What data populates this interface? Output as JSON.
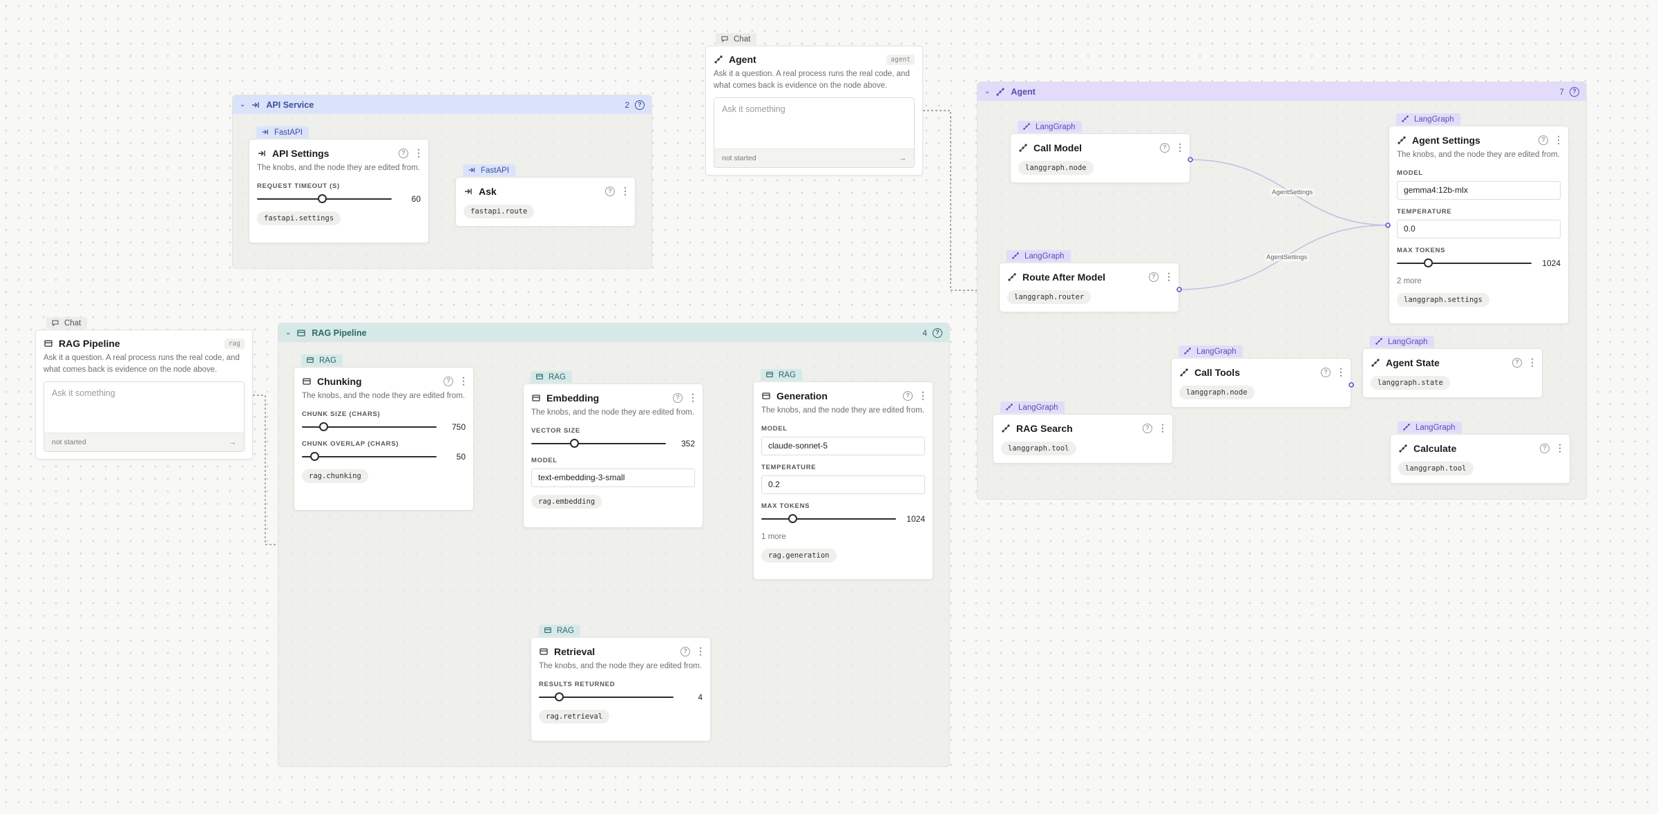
{
  "common": {
    "desc": "The knobs, and the node they are edited from.",
    "help": "?",
    "menu": "⋮",
    "collapse": "⌄"
  },
  "colors": {
    "fastapi": "#dbe3fb",
    "langgraph": "#e2dcfa",
    "rag": "#d6e9e8",
    "wire": "#5b4fd1"
  },
  "groups": {
    "api": {
      "title": "API Service",
      "count": "2"
    },
    "agent": {
      "title": "Agent",
      "count": "7"
    },
    "rag": {
      "title": "RAG Pipeline",
      "count": "4"
    }
  },
  "chat_agent": {
    "tag": "Chat",
    "title": "Agent",
    "badge": "agent",
    "desc": "Ask it a question. A real process runs the real code, and what comes back is evidence on the node above.",
    "placeholder": "Ask it something",
    "status": "not started",
    "send": "→"
  },
  "chat_rag": {
    "tag": "Chat",
    "title": "RAG Pipeline",
    "badge": "rag",
    "desc": "Ask it a question. A real process runs the real code, and what comes back is evidence on the node above.",
    "placeholder": "Ask it something",
    "status": "not started",
    "send": "→"
  },
  "api_settings": {
    "tag": "FastAPI",
    "title": "API Settings",
    "field_label": "REQUEST TIMEOUT (S)",
    "value": "60",
    "value_fraction": 0.48,
    "chip": "fastapi.settings"
  },
  "ask": {
    "tag": "FastAPI",
    "title": "Ask",
    "chip": "fastapi.route"
  },
  "call_model": {
    "tag": "LangGraph",
    "title": "Call Model",
    "chip": "langgraph.node"
  },
  "route_after_model": {
    "tag": "LangGraph",
    "title": "Route After Model",
    "chip": "langgraph.router"
  },
  "agent_settings": {
    "tag": "LangGraph",
    "title": "Agent Settings",
    "model_label": "MODEL",
    "model": "gemma4:12b-mlx",
    "temp_label": "TEMPERATURE",
    "temp": "0.0",
    "tokens_label": "MAX TOKENS",
    "tokens": "1024",
    "tokens_fraction": 0.23,
    "more": "2 more",
    "chip": "langgraph.settings"
  },
  "call_tools": {
    "tag": "LangGraph",
    "title": "Call Tools",
    "chip": "langgraph.node"
  },
  "agent_state": {
    "tag": "LangGraph",
    "title": "Agent State",
    "chip": "langgraph.state"
  },
  "rag_search": {
    "tag": "LangGraph",
    "title": "RAG Search",
    "chip": "langgraph.tool"
  },
  "calculate": {
    "tag": "LangGraph",
    "title": "Calculate",
    "chip": "langgraph.tool"
  },
  "wires": {
    "label1": "AgentSettings",
    "label2": "AgentSettings"
  },
  "chunking": {
    "tag": "RAG",
    "title": "Chunking",
    "size_label": "CHUNK SIZE (CHARS)",
    "size": "750",
    "size_fraction": 0.16,
    "overlap_label": "CHUNK OVERLAP (CHARS)",
    "overlap": "50",
    "overlap_fraction": 0.09,
    "chip": "rag.chunking"
  },
  "embedding": {
    "tag": "RAG",
    "title": "Embedding",
    "size_label": "VECTOR SIZE",
    "size": "352",
    "size_fraction": 0.32,
    "model_label": "MODEL",
    "model": "text-embedding-3-small",
    "chip": "rag.embedding"
  },
  "generation": {
    "tag": "RAG",
    "title": "Generation",
    "model_label": "MODEL",
    "model": "claude-sonnet-5",
    "temp_label": "TEMPERATURE",
    "temp": "0.2",
    "tokens_label": "MAX TOKENS",
    "tokens": "1024",
    "tokens_fraction": 0.23,
    "more": "1 more",
    "chip": "rag.generation"
  },
  "retrieval": {
    "tag": "RAG",
    "title": "Retrieval",
    "field_label": "RESULTS RETURNED",
    "value": "4",
    "value_fraction": 0.15,
    "chip": "rag.retrieval"
  }
}
